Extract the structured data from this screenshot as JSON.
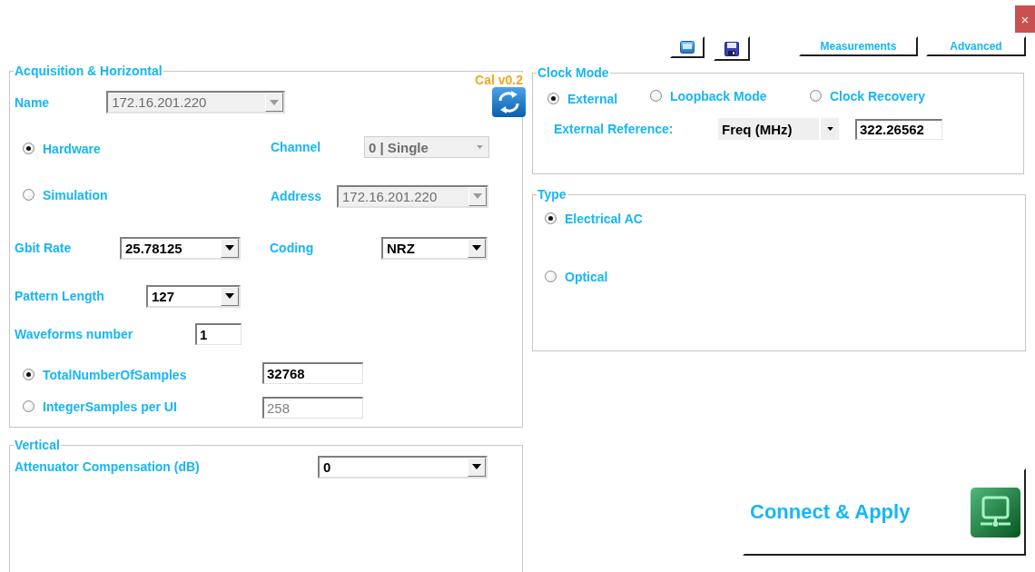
{
  "window": {
    "close_button": "×"
  },
  "toolbar": {
    "buttons": [
      {
        "label": "Measurements"
      },
      {
        "label": "Advanced"
      }
    ]
  },
  "acquisition": {
    "title": "Acquisition & Horizontal",
    "cal_label": "Cal v0.2",
    "name": {
      "label": "Name",
      "value": "172.16.201.220",
      "disabled": true
    },
    "source_options": [
      {
        "label": "Hardware",
        "selected": true
      },
      {
        "label": "Simulation",
        "selected": false
      }
    ],
    "channel": {
      "label": "Channel",
      "value": "0 | Single",
      "disabled": true
    },
    "address": {
      "label": "Address",
      "value": "172.16.201.220",
      "disabled": true
    },
    "gbit_rate": {
      "label": "Gbit Rate",
      "value": "25.78125",
      "disabled": false
    },
    "coding": {
      "label": "Coding",
      "value": "NRZ",
      "disabled": false
    },
    "pattern_length": {
      "label": "Pattern Length",
      "value": "127",
      "disabled": false
    },
    "waveforms_number": {
      "label": "Waveforms number",
      "value": "1"
    },
    "sample_modes": [
      {
        "label": "TotalNumberOfSamples",
        "value": "32768",
        "selected": true
      },
      {
        "label": "IntegerSamples per UI",
        "value": "258",
        "selected": false
      }
    ]
  },
  "vertical": {
    "title": "Vertical",
    "attenuator": {
      "label": "Attenuator Compensation (dB)",
      "value": "0",
      "disabled": false
    }
  },
  "clock_mode": {
    "title": "Clock Mode",
    "options": [
      {
        "label": "External",
        "selected": true
      },
      {
        "label": "Loopback Mode",
        "selected": false
      },
      {
        "label": "Clock Recovery",
        "selected": false
      }
    ],
    "reference": {
      "label": "External Reference:",
      "unit": "Freq (MHz)",
      "value": "322.26562"
    }
  },
  "type": {
    "title": "Type",
    "options": [
      {
        "label": "Electrical AC",
        "selected": true
      },
      {
        "label": "Optical",
        "selected": false
      }
    ]
  },
  "connect_button": {
    "label": "Connect & Apply"
  }
}
